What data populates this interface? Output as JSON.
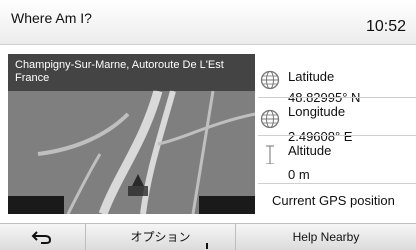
{
  "header": {
    "title": "Where Am I?",
    "clock": "10:52"
  },
  "map": {
    "address_line1": "Champigny-Sur-Marne, Autoroute De L'Est",
    "address_line2": "France"
  },
  "info": {
    "latitude_label": "Latitude",
    "latitude_value": "48.82995° N",
    "longitude_label": "Longitude",
    "longitude_value": "2.49608° E",
    "altitude_label": "Altitude",
    "altitude_value": "0 m",
    "gps_label": "Current GPS position"
  },
  "bottombar": {
    "back_icon": "return-arrow-icon",
    "options_label": "オプション",
    "help_label": "Help Nearby"
  },
  "colors": {
    "map_background": "#7f7f7f",
    "road": "#d9d9d9",
    "road_edge": "#9a9a9a"
  }
}
